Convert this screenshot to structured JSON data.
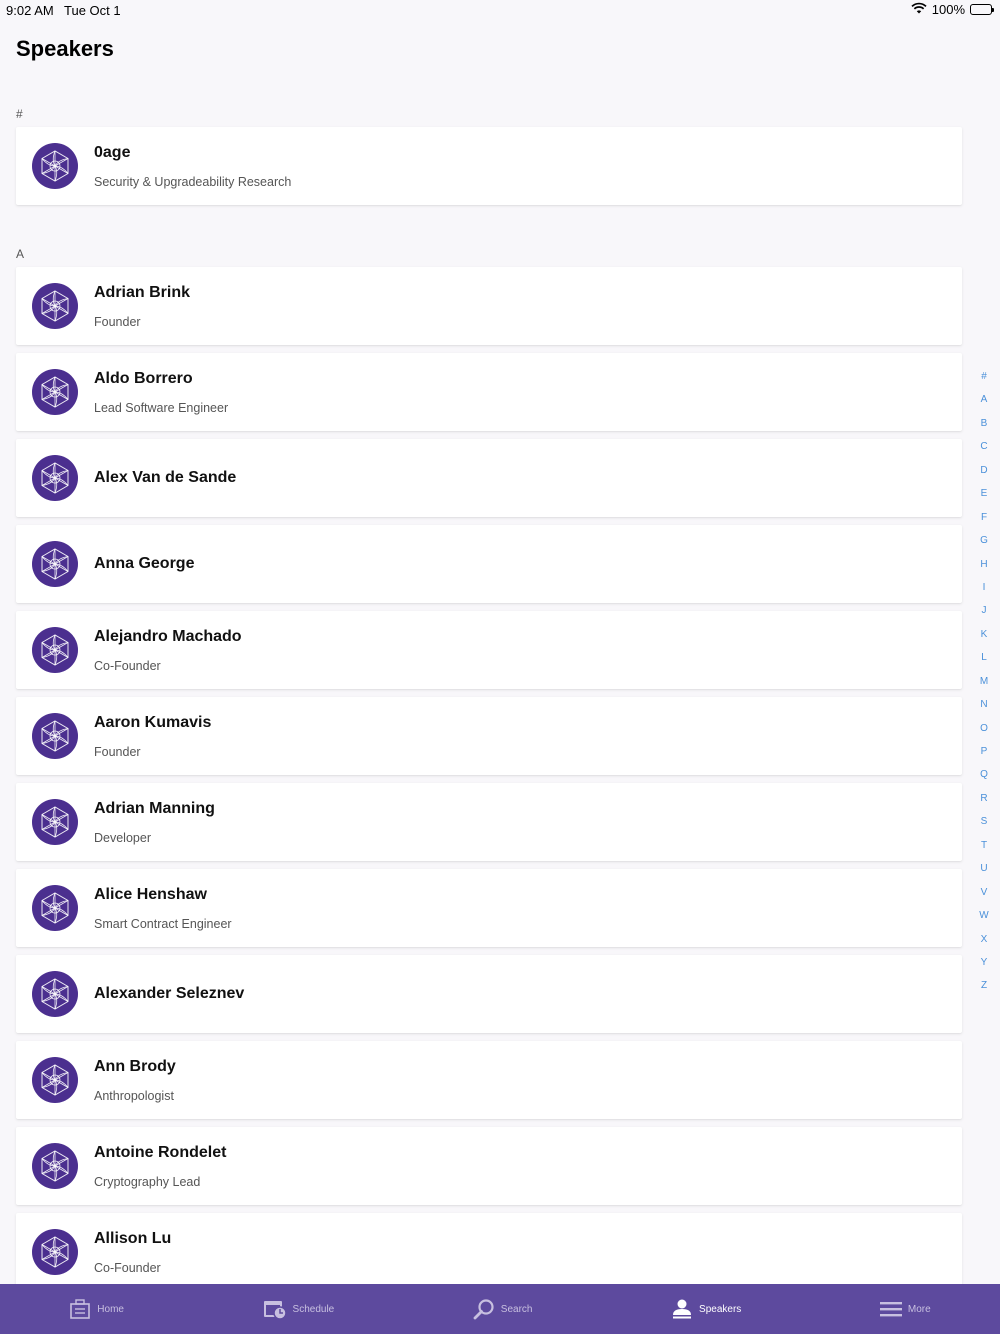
{
  "status_bar": {
    "time": "9:02 AM",
    "date": "Tue Oct 1",
    "battery": "100%"
  },
  "page": {
    "title": "Speakers"
  },
  "sections": [
    {
      "header": "#",
      "speakers": [
        {
          "name": "0age",
          "role": "Security & Upgradeability Research"
        }
      ]
    },
    {
      "header": "A",
      "speakers": [
        {
          "name": "Adrian Brink",
          "role": "Founder"
        },
        {
          "name": "Aldo Borrero",
          "role": "Lead Software Engineer"
        },
        {
          "name": "Alex Van de Sande",
          "role": ""
        },
        {
          "name": "Anna George",
          "role": ""
        },
        {
          "name": "Alejandro Machado",
          "role": "Co-Founder"
        },
        {
          "name": "Aaron Kumavis",
          "role": "Founder"
        },
        {
          "name": "Adrian Manning",
          "role": "Developer"
        },
        {
          "name": "Alice Henshaw",
          "role": "Smart Contract Engineer"
        },
        {
          "name": "Alexander Seleznev",
          "role": ""
        },
        {
          "name": "Ann Brody",
          "role": "Anthropologist"
        },
        {
          "name": "Antoine Rondelet",
          "role": "Cryptography Lead"
        },
        {
          "name": "Allison Lu",
          "role": "Co-Founder"
        }
      ]
    }
  ],
  "alpha_index": [
    "#",
    "A",
    "B",
    "C",
    "D",
    "E",
    "F",
    "G",
    "H",
    "I",
    "J",
    "K",
    "L",
    "M",
    "N",
    "O",
    "P",
    "Q",
    "R",
    "S",
    "T",
    "U",
    "V",
    "W",
    "X",
    "Y",
    "Z"
  ],
  "tab_bar": {
    "tabs": [
      {
        "label": "Home",
        "icon": "home-icon"
      },
      {
        "label": "Schedule",
        "icon": "schedule-icon"
      },
      {
        "label": "Search",
        "icon": "search-icon"
      },
      {
        "label": "Speakers",
        "icon": "speakers-icon",
        "active": true
      },
      {
        "label": "More",
        "icon": "menu-icon"
      }
    ]
  },
  "colors": {
    "avatar": "#4b2f8f",
    "tab_bar": "#5d4a9e",
    "index_letters": "#4a90d9"
  }
}
